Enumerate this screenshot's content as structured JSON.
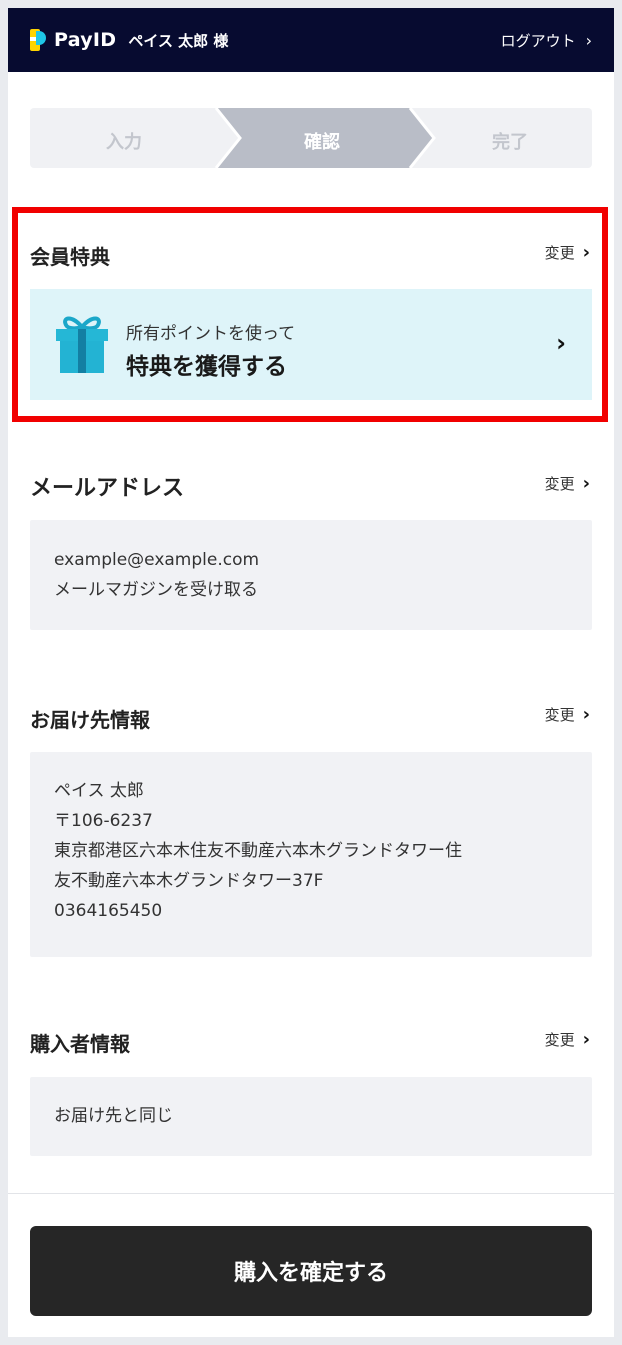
{
  "header": {
    "brand": "PayID",
    "user": "ペイス 太郎 様",
    "logout": "ログアウト",
    "logout_chevron": "›"
  },
  "steps": [
    "入力",
    "確認",
    "完了"
  ],
  "benefit": {
    "title": "会員特典",
    "change": "変更",
    "subtitle": "所有ポイントを使って",
    "main": "特典を獲得する",
    "chevron": "›"
  },
  "email": {
    "title": "メールアドレス",
    "change": "変更",
    "lines": [
      "example@example.com",
      "メールマガジンを受け取る"
    ]
  },
  "delivery": {
    "title": "お届け先情報",
    "change": "変更",
    "lines": [
      "ペイス 太郎",
      "〒106-6237",
      "東京都港区六本木住友不動産六本木グランドタワー住",
      "友不動産六本木グランドタワー37F",
      "0364165450"
    ]
  },
  "buyer": {
    "title": "購入者情報",
    "change": "変更",
    "lines": [
      "お届け先と同じ"
    ]
  },
  "confirm_button": "購入を確定する",
  "colors": {
    "header_bg": "#070b30",
    "highlight": "#f10000",
    "benefit_bg": "#def4f9",
    "card_bg": "#f1f2f5",
    "button_bg": "#262626",
    "logo_yellow": "#ffd400",
    "logo_cyan": "#1ec6e6"
  },
  "icons": {
    "logo": "payid-logo-icon",
    "gift": "gift-box-icon",
    "chevron": "chevron-right-icon"
  }
}
